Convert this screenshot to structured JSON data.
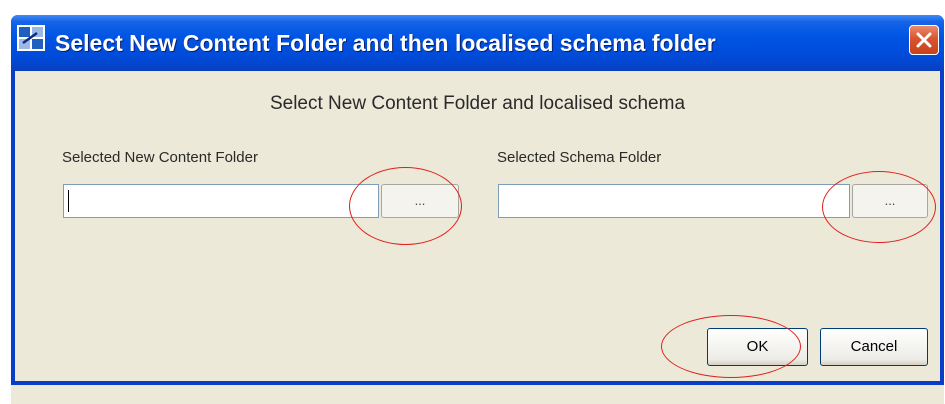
{
  "window": {
    "title": "Select New Content Folder and then localised schema folder",
    "close_label": "×"
  },
  "dialog": {
    "heading": "Select New Content Folder and localised schema",
    "content_folder": {
      "label": "Selected New Content Folder",
      "value": "",
      "browse_label": "..."
    },
    "schema_folder": {
      "label": "Selected Schema Folder",
      "value": "",
      "browse_label": "..."
    },
    "ok_label": "OK",
    "cancel_label": "Cancel"
  },
  "colors": {
    "annotation": "#e0201c",
    "titlebar": "#0054e3",
    "close_button": "#d9552f"
  }
}
